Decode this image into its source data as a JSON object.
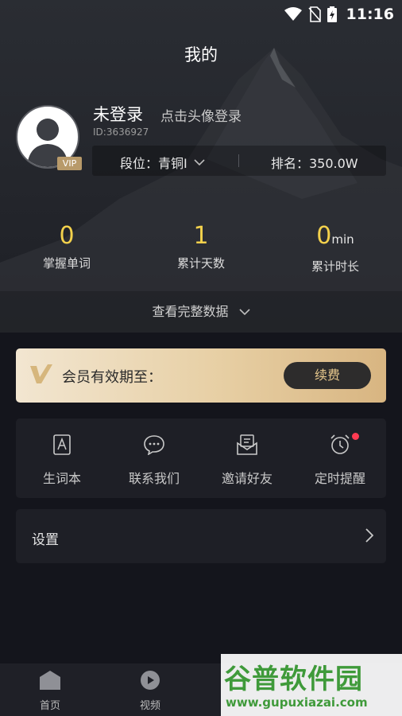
{
  "status_bar": {
    "time": "11:16",
    "icons": [
      "wifi-icon",
      "no-sim-icon",
      "battery-charging-icon"
    ]
  },
  "header": {
    "title": "我的"
  },
  "profile": {
    "username": "未登录",
    "login_hint": "点击头像登录",
    "user_id": "ID:3636927",
    "vip_badge": "VIP",
    "rank_level": "段位：青铜I",
    "rank_position": "排名：350.0W"
  },
  "stats": [
    {
      "value": "0",
      "unit": "",
      "label": "掌握单词"
    },
    {
      "value": "1",
      "unit": "",
      "label": "累计天数"
    },
    {
      "value": "0",
      "unit": "min",
      "label": "累计时长"
    }
  ],
  "view_data": {
    "label": "查看完整数据"
  },
  "vip_card": {
    "text": "会员有效期至：",
    "button": "续费",
    "colors": {
      "gold_start": "#f2e6d1",
      "gold_end": "#d8b581",
      "button_bg": "#2d2c2c",
      "button_text": "#e8c98d"
    }
  },
  "tools": [
    {
      "label": "生词本",
      "icon": "vocabulary-book-icon"
    },
    {
      "label": "联系我们",
      "icon": "chat-bubble-icon"
    },
    {
      "label": "邀请好友",
      "icon": "invite-mail-icon"
    },
    {
      "label": "定时提醒",
      "icon": "alarm-clock-icon",
      "has_notification": true
    }
  ],
  "settings": {
    "label": "设置"
  },
  "tab_bar": [
    {
      "label": "首页",
      "icon": "home-icon"
    },
    {
      "label": "视频",
      "icon": "video-play-icon"
    }
  ],
  "watermark": {
    "main": "谷普软件园",
    "url": "www.gupuxiazai.com"
  },
  "colors": {
    "background": "#14151c",
    "accent_yellow": "#f3d14c",
    "notification_red": "#ff3b52"
  }
}
